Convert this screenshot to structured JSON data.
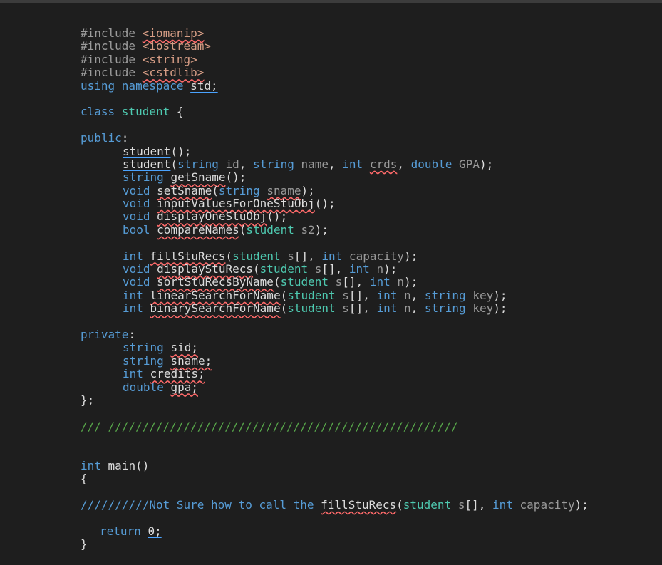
{
  "lines": [
    [
      "#include ",
      "<iomanip>"
    ],
    [
      "#include ",
      "<iostream>"
    ],
    [
      "#include ",
      "<string>"
    ],
    [
      "#include ",
      "<cstdlib>"
    ],
    [
      "using namespace ",
      "std;"
    ],
    [],
    [
      "class ",
      "student ",
      "{"
    ],
    [],
    [
      "public",
      ":"
    ],
    [
      "student",
      "();"
    ],
    [
      "student",
      "(",
      "string",
      " id",
      ", ",
      "string",
      " name",
      ", ",
      "int",
      " ",
      "crds",
      ", ",
      "double",
      " GPA",
      ");"
    ],
    [
      "string",
      " ",
      "getSname",
      "();"
    ],
    [
      "void",
      " ",
      "setSname",
      "(",
      "string",
      " ",
      "sname",
      ");"
    ],
    [
      "void",
      " ",
      "inputValuesForOneStuObj",
      "();"
    ],
    [
      "void",
      " ",
      "displayOneStuObj",
      "();"
    ],
    [
      "bool",
      " ",
      "compareNames",
      "(",
      "student",
      " s2",
      ");"
    ],
    [],
    [
      "int",
      " ",
      "fillStuRecs",
      "(",
      "student",
      " s",
      "[], ",
      "int",
      " capacity",
      ");"
    ],
    [
      "void",
      " ",
      "displayStuRecs",
      "(",
      "student",
      " s",
      "[], ",
      "int",
      " n",
      ");"
    ],
    [
      "void",
      " ",
      "sortStuRecsByName",
      "(",
      "student",
      " s",
      "[], ",
      "int",
      " n",
      ");"
    ],
    [
      "int",
      " ",
      "linearSearchForName",
      "(",
      "student",
      " s",
      "[], ",
      "int",
      " n",
      ", ",
      "string",
      " key",
      ");"
    ],
    [
      "int",
      " ",
      "binarySearchForName",
      "(",
      "student",
      " s",
      "[], ",
      "int",
      " n",
      ", ",
      "string",
      " key",
      ");"
    ],
    [],
    [
      "private",
      ":"
    ],
    [
      "string",
      " ",
      "sid;"
    ],
    [
      "string",
      " ",
      "sname;"
    ],
    [
      "int",
      " ",
      "credits;"
    ],
    [
      "double",
      " ",
      "gpa;"
    ],
    [
      "};"
    ],
    [],
    [
      "/// ///////////////////////////////////////////////////"
    ],
    [],
    [],
    [
      "int",
      " ",
      "main",
      "()"
    ],
    [
      "{"
    ],
    [],
    [
      "//////////Not Sure how to call the ",
      "fillStuRecs",
      "(",
      "student",
      " s",
      "[], ",
      "int",
      " capacity",
      ");"
    ],
    [],
    [
      "return",
      " ",
      "0;"
    ],
    [
      "}"
    ]
  ]
}
